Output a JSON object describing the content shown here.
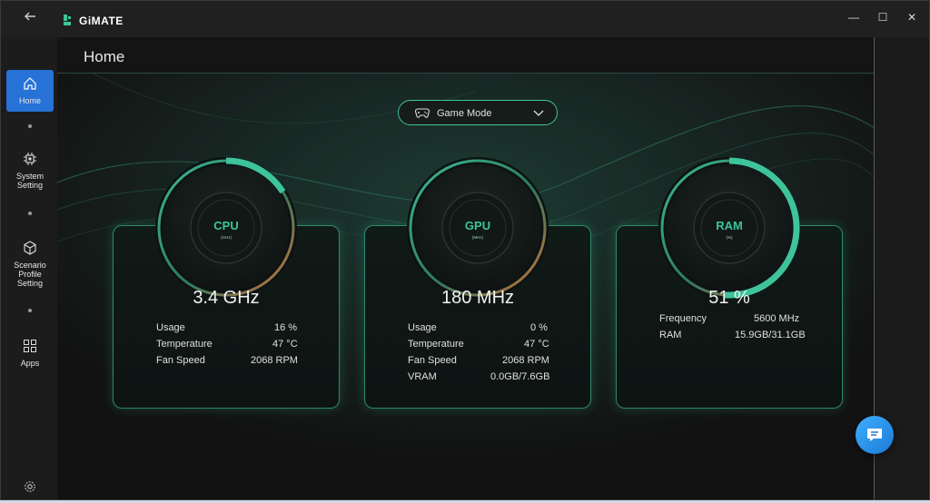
{
  "app": {
    "name": "GiMATE"
  },
  "window_controls": {
    "minimize": "—",
    "maximize": "☐",
    "close": "✕"
  },
  "sidebar": {
    "items": [
      {
        "label": "Home",
        "icon": "home-icon",
        "active": true
      },
      {
        "label": "System Setting",
        "icon": "chip-icon"
      },
      {
        "label": "Scenario Profile Setting",
        "icon": "cube-icon"
      },
      {
        "label": "Apps",
        "icon": "apps-grid-icon"
      }
    ],
    "settings_icon": "gear-icon"
  },
  "header": {
    "title": "Home"
  },
  "mode_select": {
    "value": "Game Mode",
    "icon": "gamepad-icon"
  },
  "cards": {
    "cpu": {
      "label": "CPU",
      "unit": "(GHz)",
      "value": "3.4 GHz",
      "gauge_fraction": 0.16,
      "rows": [
        {
          "k": "Usage",
          "v": "16 %"
        },
        {
          "k": "Temperature",
          "v": "47 °C"
        },
        {
          "k": "Fan Speed",
          "v": "2068 RPM"
        }
      ]
    },
    "gpu": {
      "label": "GPU",
      "unit": "(MHz)",
      "value": "180 MHz",
      "gauge_fraction": 0.0,
      "rows": [
        {
          "k": "Usage",
          "v": "0 %"
        },
        {
          "k": "Temperature",
          "v": "47 °C"
        },
        {
          "k": "Fan Speed",
          "v": "2068 RPM"
        },
        {
          "k": "VRAM",
          "v": "0.0GB/7.6GB"
        }
      ]
    },
    "ram": {
      "label": "RAM",
      "unit": "(%)",
      "value": "51 %",
      "gauge_fraction": 0.51,
      "rows": [
        {
          "k": "Frequency",
          "v": "5600 MHz"
        },
        {
          "k": "RAM",
          "v": "15.9GB/31.1GB"
        }
      ]
    }
  },
  "colors": {
    "accent": "#3ec39b",
    "active_nav": "#2672d6",
    "gauge_warm": "#d9733a",
    "chat": "#2b93ee"
  }
}
